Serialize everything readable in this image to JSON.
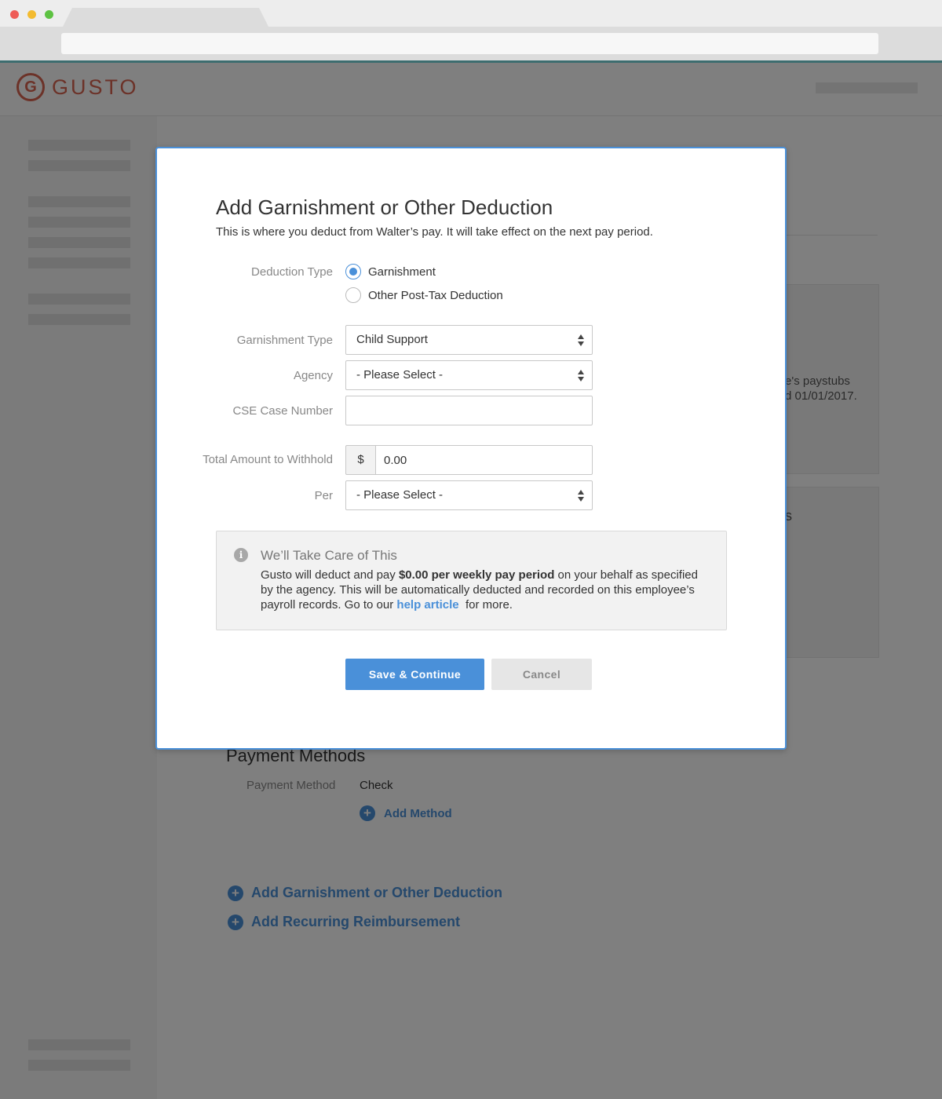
{
  "brand": {
    "logo_letter": "G",
    "name": "GUSTO",
    "color": "#d96451"
  },
  "background": {
    "partial_texts": [
      "e's paystubs",
      "d 01/01/2017.",
      "s"
    ],
    "payment_methods": {
      "heading": "Payment Methods",
      "label": "Payment Method",
      "value": "Check",
      "add_method": "Add Method"
    },
    "actions": {
      "add_garnishment": "Add Garnishment or Other Deduction",
      "add_reimbursement": "Add Recurring Reimbursement"
    }
  },
  "modal": {
    "title": "Add Garnishment or Other Deduction",
    "subtitle": "This is where you deduct from Walter’s pay. It will take effect on the next pay period.",
    "deduction_type": {
      "label": "Deduction Type",
      "options": [
        {
          "label": "Garnishment",
          "checked": true
        },
        {
          "label": "Other Post-Tax Deduction",
          "checked": false
        }
      ]
    },
    "garnishment_type": {
      "label": "Garnishment Type",
      "value": "Child Support"
    },
    "agency": {
      "label": "Agency",
      "value": "- Please Select -"
    },
    "cse_case_number": {
      "label": "CSE Case Number",
      "value": ""
    },
    "total_amount": {
      "label": "Total Amount to Withhold",
      "prefix": "$",
      "value": "0.00"
    },
    "per": {
      "label": "Per",
      "value": "- Please Select -"
    },
    "info": {
      "icon": "info-icon",
      "title": "We’ll Take Care of This",
      "text_1": "Gusto will deduct and pay ",
      "bold": "$0.00 per weekly pay period",
      "text_2": " on your behalf as specified by the agency. This will be automatically deducted and recorded on this employee’s payroll records. Go to our ",
      "link": "help article",
      "text_3": "  for more."
    },
    "buttons": {
      "save": "Save & Continue",
      "cancel": "Cancel"
    }
  },
  "colors": {
    "accent": "#4a90d9",
    "overlay": "rgba(0,0,0,0.5)"
  }
}
